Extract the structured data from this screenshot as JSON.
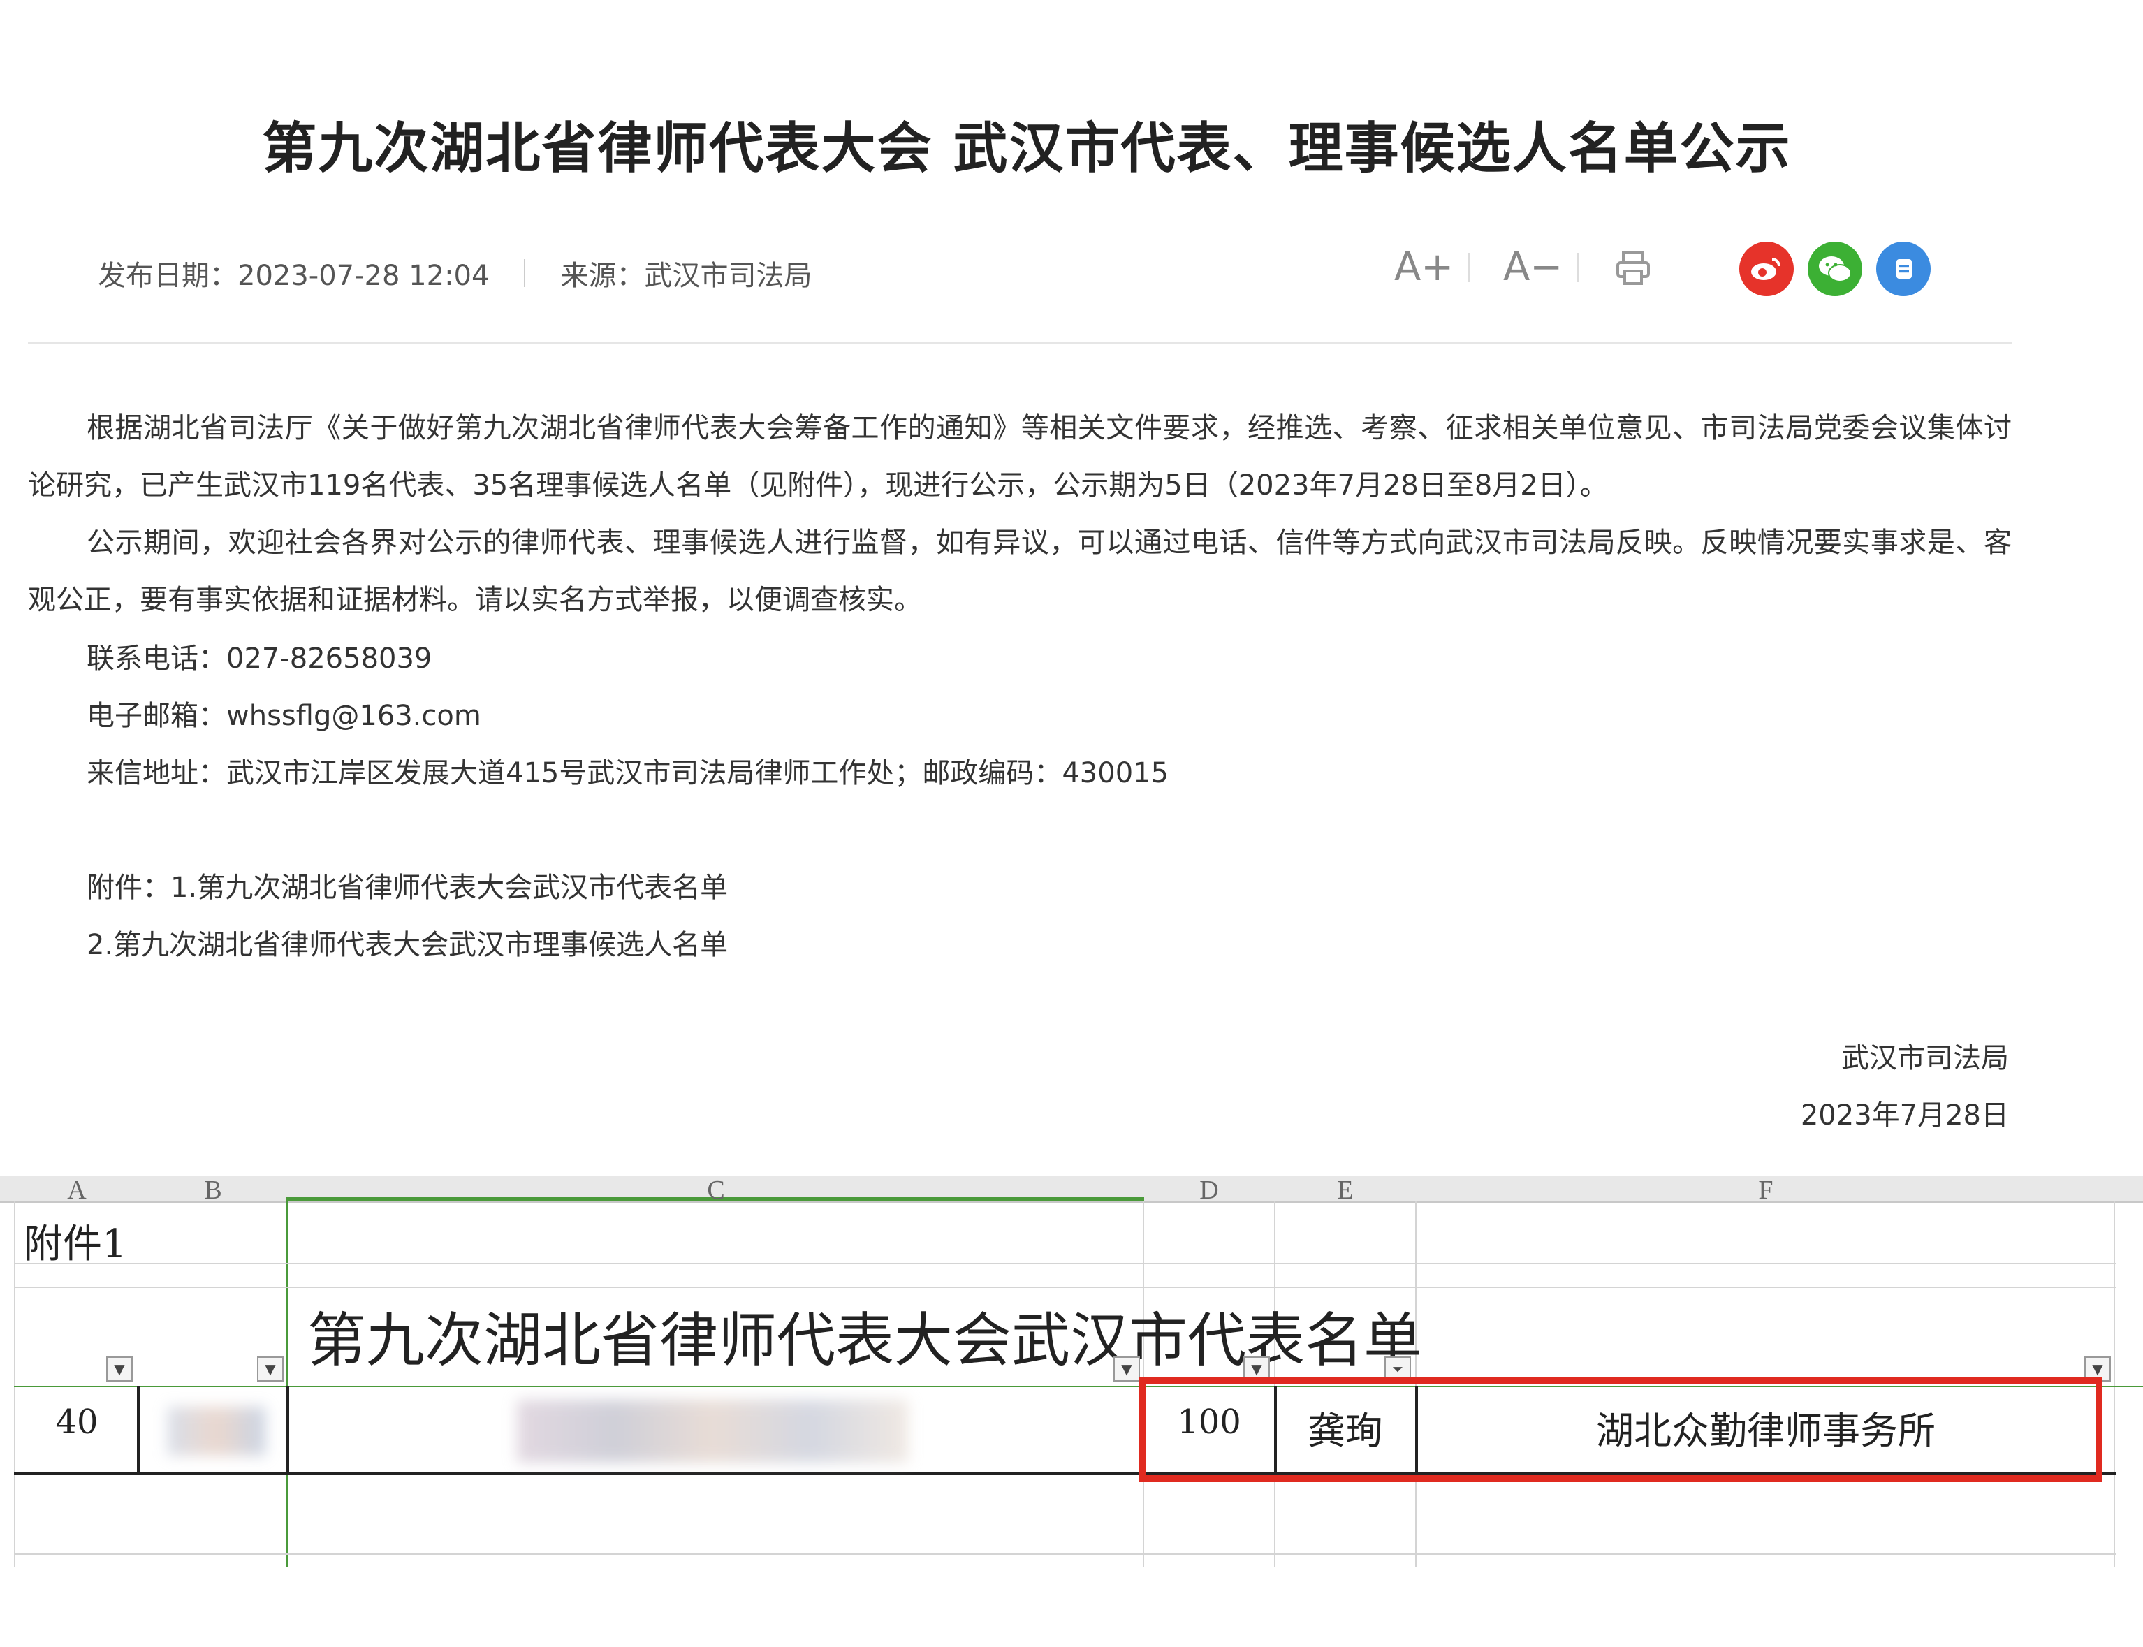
{
  "article": {
    "title": "第九次湖北省律师代表大会 武汉市代表、理事候选人名单公示",
    "publish_date": "发布日期：2023-07-28 12:04",
    "source": "来源：武汉市司法局",
    "tools": {
      "font_larger": "A+",
      "font_smaller": "A−",
      "print": "🖶"
    },
    "paragraph1": "根据湖北省司法厅《关于做好第九次湖北省律师代表大会筹备工作的通知》等相关文件要求，经推选、考察、征求相关单位意见、市司法局党委会议集体讨论研究，已产生武汉市119名代表、35名理事候选人名单（见附件），现进行公示，公示期为5日（2023年7月28日至8月2日）。",
    "paragraph2": "公示期间，欢迎社会各界对公示的律师代表、理事候选人进行监督，如有异议，可以通过电话、信件等方式向武汉市司法局反映。反映情况要实事求是、客观公正，要有事实依据和证据材料。请以实名方式举报，以便调查核实。",
    "phone": "联系电话：027-82658039",
    "email": "电子邮箱：whssflg@163.com",
    "address": "来信地址：武汉市江岸区发展大道415号武汉市司法局律师工作处；邮政编码：430015",
    "attachment1": "附件：1.第九次湖北省律师代表大会武汉市代表名单",
    "attachment2": "2.第九次湖北省律师代表大会武汉市理事候选人名单",
    "signature": "武汉市司法局",
    "sign_date": "2023年7月28日"
  },
  "share": {
    "weibo_color": "#e6332a",
    "wechat_color": "#3cb034",
    "other_color": "#3b8be0"
  },
  "sheet": {
    "columns": [
      "A",
      "B",
      "C",
      "D",
      "E",
      "F"
    ],
    "attachment_label": "附件1",
    "list_title": "第九次湖北省律师代表大会武汉市代表名单",
    "row": {
      "a": "40",
      "d": "100",
      "e": "龚珣",
      "f": "湖北众勤律师事务所"
    },
    "highlight_color": "#e02a20"
  }
}
